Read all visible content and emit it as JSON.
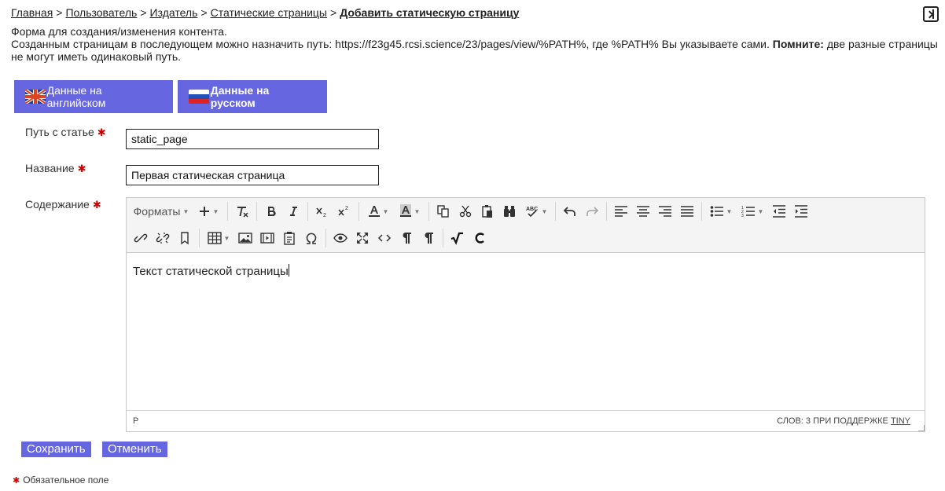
{
  "breadcrumb": {
    "items": [
      "Главная",
      "Пользователь",
      "Издатель",
      "Статические страницы"
    ],
    "separator": ">",
    "current": "Добавить статическую страницу"
  },
  "intro": {
    "line1": "Форма для создания/изменения контента.",
    "line2": "Созданным страницам в последующем можно назначить путь: https://f23g45.rcsi.science/23/pages/view/%PATH%, где %PATH% Вы указываете сами.",
    "remember_label": "Помните:",
    "remember_text": "две разные страницы не могут иметь одинаковый путь."
  },
  "tabs": {
    "english": "Данные на английском",
    "russian": "Данные на русском"
  },
  "form": {
    "required_mark": "✱",
    "path_label": "Путь с статье",
    "path_value": "static_page",
    "name_label": "Название",
    "name_value": "Первая статическая страница",
    "content_label": "Содержание"
  },
  "editor": {
    "formats_label": "Форматы",
    "content_text": "Текст статической страницы",
    "status_element": "P",
    "word_count": "СЛОВ: 3 ПРИ ПОДДЕРЖКЕ",
    "powered_by": "TINY"
  },
  "actions": {
    "save": "Сохранить",
    "cancel": "Отменить"
  },
  "footnote": {
    "text": "Обязательное поле"
  },
  "colors": {
    "accent": "#6666e0",
    "required": "#cc0000"
  }
}
